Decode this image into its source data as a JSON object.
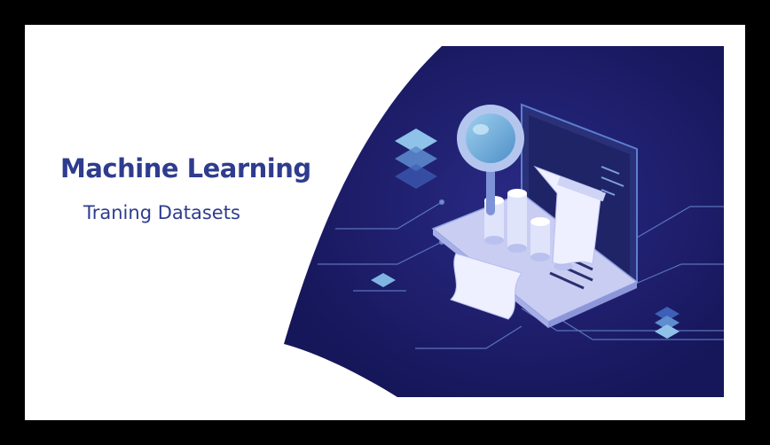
{
  "banner": {
    "title": "Machine Learning",
    "subtitle": "Traning Datasets"
  },
  "illustration": {
    "subject": "isometric laptop with magnifying glass, paper receipt and cylinder bar graph",
    "icons": [
      "laptop-icon",
      "magnifier-icon",
      "receipt-icon",
      "cylinder-chart-icon",
      "stacked-layers-icon"
    ]
  },
  "colors": {
    "frame": "#000000",
    "background": "#ffffff",
    "text": "#2e3c8f",
    "navy": "#1c1c66",
    "accent": "#8fb6e6"
  }
}
